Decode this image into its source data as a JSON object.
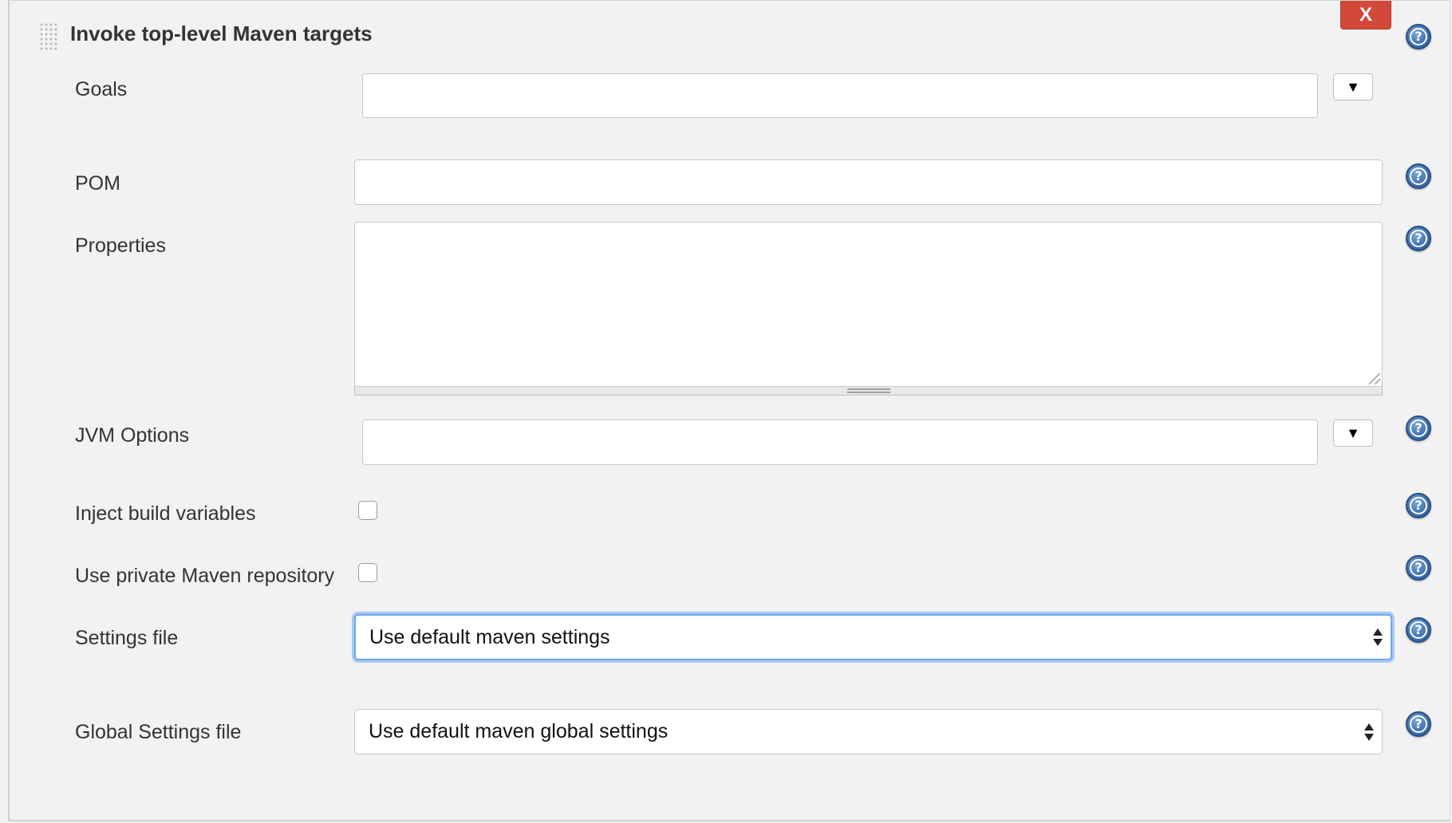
{
  "section": {
    "title": "Invoke top-level Maven targets",
    "delete_label": "X"
  },
  "fields": {
    "goals": {
      "label": "Goals",
      "value": ""
    },
    "pom": {
      "label": "POM",
      "value": ""
    },
    "properties": {
      "label": "Properties",
      "value": ""
    },
    "jvm_options": {
      "label": "JVM Options",
      "value": ""
    },
    "inject_build_variables": {
      "label": "Inject build variables",
      "checked": false
    },
    "use_private_repo": {
      "label": "Use private Maven repository",
      "checked": false
    },
    "settings_file": {
      "label": "Settings file",
      "selected": "Use default maven settings"
    },
    "global_settings_file": {
      "label": "Global Settings file",
      "selected": "Use default maven global settings"
    }
  },
  "icons": {
    "help": "help-icon",
    "dropdown": "triangle-down-icon",
    "drag": "drag-handle-icon"
  },
  "colors": {
    "delete_button": "#d24939",
    "help_icon": "#3f72b2",
    "focus_ring": "#6aa8f0",
    "background": "#f2f2f2"
  }
}
